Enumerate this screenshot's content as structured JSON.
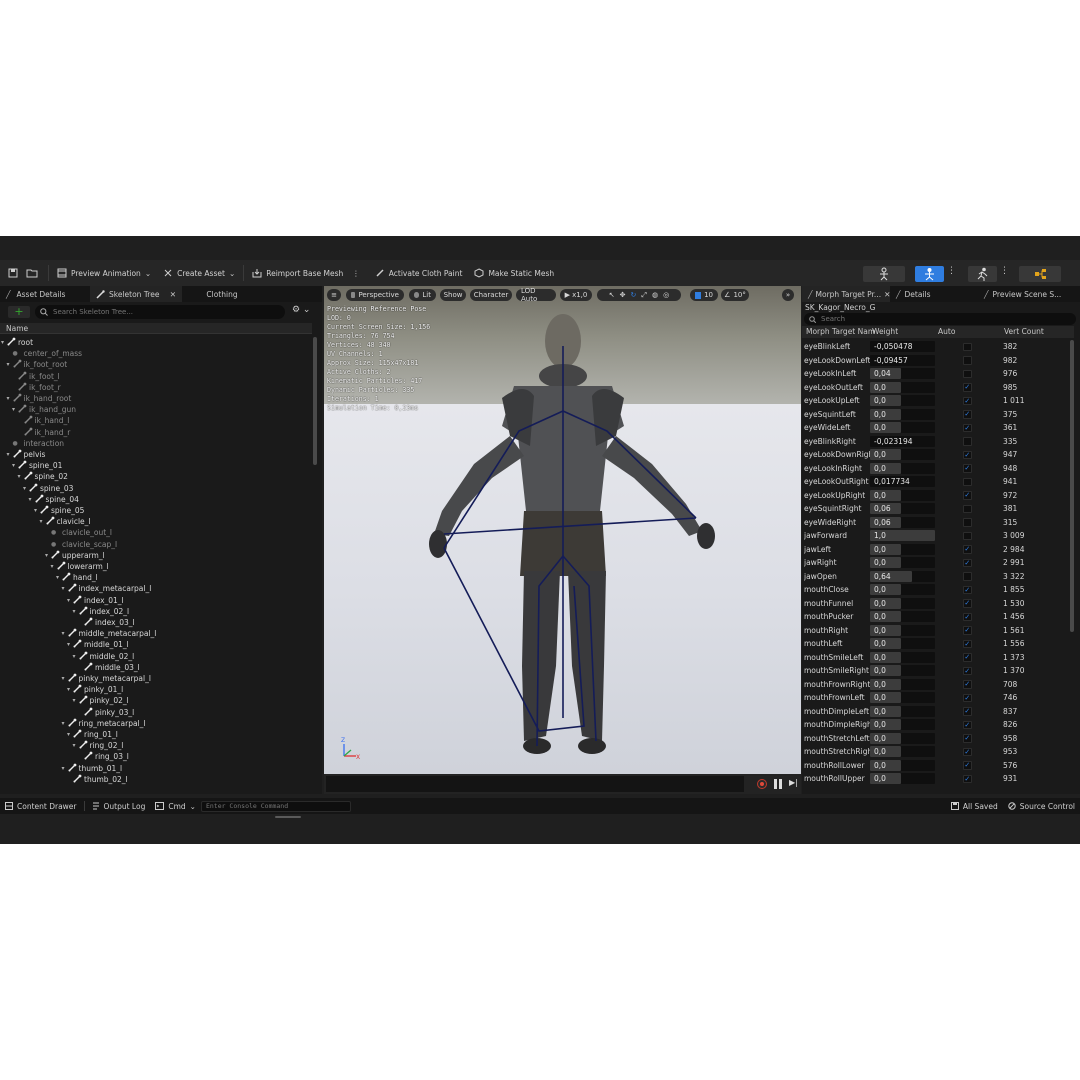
{
  "toolbar": {
    "preview_animation": "Preview Animation",
    "create_asset": "Create Asset",
    "reimport": "Reimport Base Mesh",
    "activate_cloth": "Activate Cloth Paint",
    "make_static": "Make Static Mesh"
  },
  "left_tabs": {
    "asset_details": "Asset Details",
    "skeleton_tree": "Skeleton Tree",
    "clothing": "Clothing"
  },
  "skeleton_search": {
    "placeholder": "Search Skeleton Tree..."
  },
  "tree_header": "Name",
  "tree": [
    {
      "name": "root",
      "depth": 0,
      "kind": "bone"
    },
    {
      "name": "center_of_mass",
      "depth": 1,
      "kind": "socket"
    },
    {
      "name": "ik_foot_root",
      "depth": 1,
      "kind": "bone",
      "dim": true
    },
    {
      "name": "ik_foot_l",
      "depth": 2,
      "kind": "bone",
      "dim": true
    },
    {
      "name": "ik_foot_r",
      "depth": 2,
      "kind": "bone",
      "dim": true
    },
    {
      "name": "ik_hand_root",
      "depth": 1,
      "kind": "bone",
      "dim": true
    },
    {
      "name": "ik_hand_gun",
      "depth": 2,
      "kind": "bone",
      "dim": true
    },
    {
      "name": "ik_hand_l",
      "depth": 3,
      "kind": "bone",
      "dim": true
    },
    {
      "name": "ik_hand_r",
      "depth": 3,
      "kind": "bone",
      "dim": true
    },
    {
      "name": "interaction",
      "depth": 1,
      "kind": "socket"
    },
    {
      "name": "pelvis",
      "depth": 1,
      "kind": "bone"
    },
    {
      "name": "spine_01",
      "depth": 2,
      "kind": "bone"
    },
    {
      "name": "spine_02",
      "depth": 3,
      "kind": "bone"
    },
    {
      "name": "spine_03",
      "depth": 4,
      "kind": "bone"
    },
    {
      "name": "spine_04",
      "depth": 5,
      "kind": "bone"
    },
    {
      "name": "spine_05",
      "depth": 6,
      "kind": "bone"
    },
    {
      "name": "clavicle_l",
      "depth": 7,
      "kind": "bone"
    },
    {
      "name": "clavicle_out_l",
      "depth": 8,
      "kind": "socket"
    },
    {
      "name": "clavicle_scap_l",
      "depth": 8,
      "kind": "socket"
    },
    {
      "name": "upperarm_l",
      "depth": 8,
      "kind": "bone"
    },
    {
      "name": "lowerarm_l",
      "depth": 9,
      "kind": "bone"
    },
    {
      "name": "hand_l",
      "depth": 10,
      "kind": "bone"
    },
    {
      "name": "index_metacarpal_l",
      "depth": 11,
      "kind": "bone"
    },
    {
      "name": "index_01_l",
      "depth": 12,
      "kind": "bone"
    },
    {
      "name": "index_02_l",
      "depth": 13,
      "kind": "bone"
    },
    {
      "name": "index_03_l",
      "depth": 14,
      "kind": "bone"
    },
    {
      "name": "middle_metacarpal_l",
      "depth": 11,
      "kind": "bone"
    },
    {
      "name": "middle_01_l",
      "depth": 12,
      "kind": "bone"
    },
    {
      "name": "middle_02_l",
      "depth": 13,
      "kind": "bone"
    },
    {
      "name": "middle_03_l",
      "depth": 14,
      "kind": "bone"
    },
    {
      "name": "pinky_metacarpal_l",
      "depth": 11,
      "kind": "bone"
    },
    {
      "name": "pinky_01_l",
      "depth": 12,
      "kind": "bone"
    },
    {
      "name": "pinky_02_l",
      "depth": 13,
      "kind": "bone"
    },
    {
      "name": "pinky_03_l",
      "depth": 14,
      "kind": "bone"
    },
    {
      "name": "ring_metacarpal_l",
      "depth": 11,
      "kind": "bone"
    },
    {
      "name": "ring_01_l",
      "depth": 12,
      "kind": "bone"
    },
    {
      "name": "ring_02_l",
      "depth": 13,
      "kind": "bone"
    },
    {
      "name": "ring_03_l",
      "depth": 14,
      "kind": "bone"
    },
    {
      "name": "thumb_01_l",
      "depth": 11,
      "kind": "bone"
    },
    {
      "name": "thumb_02_l",
      "depth": 12,
      "kind": "bone"
    }
  ],
  "viewport": {
    "perspective": "Perspective",
    "lit": "Lit",
    "show": "Show",
    "character": "Character",
    "lod": "LOD Auto",
    "speed": "x1,0",
    "grid": "10",
    "angle": "10°",
    "stats": [
      "Previewing Reference Pose",
      "LOD: 0",
      "Current Screen Size: 1,156",
      "Triangles: 76 754",
      "Vertices: 48 340",
      "UV Channels: 1",
      "Approx Size: 115x47x181",
      "Active Cloths: 2",
      "Kinematic Particles: 417",
      "Dynamic Particles: 335",
      "Iterations: 1",
      "Simulation Time: 0,23ms"
    ]
  },
  "right_tabs": {
    "morph": "Morph Target Pr...",
    "details": "Details",
    "preview": "Preview Scene S..."
  },
  "morph": {
    "asset": "SK_Kagor_Necro_G",
    "search_placeholder": "Search",
    "headers": {
      "name": "Morph Target Nam",
      "weight": "Weight",
      "auto": "Auto",
      "vert": "Vert Count"
    },
    "rows": [
      {
        "name": "eyeBlinkLeft",
        "weight": "-0,050478",
        "fill": 0,
        "auto": false,
        "verts": "382"
      },
      {
        "name": "eyeLookDownLeft",
        "weight": "-0,09457",
        "fill": 0,
        "auto": false,
        "verts": "982"
      },
      {
        "name": "eyeLookInLeft",
        "weight": "0,04",
        "fill": 0.04,
        "auto": false,
        "verts": "976"
      },
      {
        "name": "eyeLookOutLeft",
        "weight": "0,0",
        "fill": 0,
        "auto": true,
        "verts": "985"
      },
      {
        "name": "eyeLookUpLeft",
        "weight": "0,0",
        "fill": 0,
        "auto": true,
        "verts": "1 011"
      },
      {
        "name": "eyeSquintLeft",
        "weight": "0,0",
        "fill": 0,
        "auto": true,
        "verts": "375"
      },
      {
        "name": "eyeWideLeft",
        "weight": "0,0",
        "fill": 0,
        "auto": true,
        "verts": "361"
      },
      {
        "name": "eyeBlinkRight",
        "weight": "-0,023194",
        "fill": 0,
        "auto": false,
        "verts": "335"
      },
      {
        "name": "eyeLookDownRight",
        "weight": "0,0",
        "fill": 0,
        "auto": true,
        "verts": "947"
      },
      {
        "name": "eyeLookInRight",
        "weight": "0,0",
        "fill": 0,
        "auto": true,
        "verts": "948"
      },
      {
        "name": "eyeLookOutRight",
        "weight": "0,017734",
        "fill": 0.017734,
        "auto": false,
        "verts": "941"
      },
      {
        "name": "eyeLookUpRight",
        "weight": "0,0",
        "fill": 0,
        "auto": true,
        "verts": "972"
      },
      {
        "name": "eyeSquintRight",
        "weight": "0,06",
        "fill": 0.06,
        "auto": false,
        "verts": "381"
      },
      {
        "name": "eyeWideRight",
        "weight": "0,06",
        "fill": 0.06,
        "auto": false,
        "verts": "315"
      },
      {
        "name": "jawForward",
        "weight": "1,0",
        "fill": 1,
        "auto": false,
        "verts": "3 009"
      },
      {
        "name": "jawLeft",
        "weight": "0,0",
        "fill": 0,
        "auto": true,
        "verts": "2 984"
      },
      {
        "name": "jawRight",
        "weight": "0,0",
        "fill": 0,
        "auto": true,
        "verts": "2 991"
      },
      {
        "name": "jawOpen",
        "weight": "0,64",
        "fill": 0.64,
        "auto": false,
        "verts": "3 322"
      },
      {
        "name": "mouthClose",
        "weight": "0,0",
        "fill": 0,
        "auto": true,
        "verts": "1 855"
      },
      {
        "name": "mouthFunnel",
        "weight": "0,0",
        "fill": 0,
        "auto": true,
        "verts": "1 530"
      },
      {
        "name": "mouthPucker",
        "weight": "0,0",
        "fill": 0,
        "auto": true,
        "verts": "1 456"
      },
      {
        "name": "mouthRight",
        "weight": "0,0",
        "fill": 0,
        "auto": true,
        "verts": "1 561"
      },
      {
        "name": "mouthLeft",
        "weight": "0,0",
        "fill": 0,
        "auto": true,
        "verts": "1 556"
      },
      {
        "name": "mouthSmileLeft",
        "weight": "0,0",
        "fill": 0,
        "auto": true,
        "verts": "1 373"
      },
      {
        "name": "mouthSmileRight",
        "weight": "0,0",
        "fill": 0,
        "auto": true,
        "verts": "1 370"
      },
      {
        "name": "mouthFrownRight",
        "weight": "0,0",
        "fill": 0,
        "auto": true,
        "verts": "708"
      },
      {
        "name": "mouthFrownLeft",
        "weight": "0,0",
        "fill": 0,
        "auto": true,
        "verts": "746"
      },
      {
        "name": "mouthDimpleLeft",
        "weight": "0,0",
        "fill": 0,
        "auto": true,
        "verts": "837"
      },
      {
        "name": "mouthDimpleRight",
        "weight": "0,0",
        "fill": 0,
        "auto": true,
        "verts": "826"
      },
      {
        "name": "mouthStretchLeft",
        "weight": "0,0",
        "fill": 0,
        "auto": true,
        "verts": "958"
      },
      {
        "name": "mouthStretchRight",
        "weight": "0,0",
        "fill": 0,
        "auto": true,
        "verts": "953"
      },
      {
        "name": "mouthRollLower",
        "weight": "0,0",
        "fill": 0,
        "auto": true,
        "verts": "576"
      },
      {
        "name": "mouthRollUpper",
        "weight": "0,0",
        "fill": 0,
        "auto": true,
        "verts": "931"
      }
    ]
  },
  "bottom": {
    "content_drawer": "Content Drawer",
    "output_log": "Output Log",
    "cmd": "Cmd",
    "console_placeholder": "Enter Console Command",
    "all_saved": "All Saved",
    "source_control": "Source Control"
  },
  "colors": {
    "accent_blue": "#2f7de0",
    "check_blue": "#2f7de0",
    "add_green": "#35a82f",
    "bone_blue": "#141c58"
  }
}
